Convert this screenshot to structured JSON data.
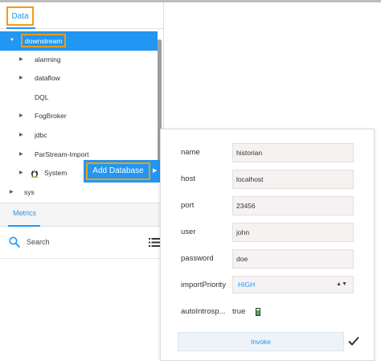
{
  "tabs": {
    "data_label": "Data",
    "metrics_label": "Metrics"
  },
  "tree": {
    "selected": "downstream",
    "items": [
      {
        "label": "alarming"
      },
      {
        "label": "dataflow"
      },
      {
        "label": "DQL"
      },
      {
        "label": "FogBroker"
      },
      {
        "label": "jdbc"
      },
      {
        "label": "ParStream-Import"
      },
      {
        "label": "System"
      },
      {
        "label": "sys"
      }
    ]
  },
  "context_menu": {
    "label": "Add Database"
  },
  "search": {
    "placeholder": "Search"
  },
  "form": {
    "name": {
      "label": "name",
      "value": "historian"
    },
    "host": {
      "label": "host",
      "value": "localhost"
    },
    "port": {
      "label": "port",
      "value": "23456"
    },
    "user": {
      "label": "user",
      "value": "john"
    },
    "password": {
      "label": "password",
      "value": "doe"
    },
    "import_priority": {
      "label": "importPriority",
      "value": "HIGH"
    },
    "auto_introspect": {
      "label": "autoIntrosp...",
      "value": "true"
    },
    "invoke_label": "Invoke"
  },
  "colors": {
    "accent": "#2196f3",
    "highlight": "#f39c12",
    "toggle_on": "#4caf50"
  },
  "icons": [
    "expand-arrow-icon",
    "linux-icon",
    "search-icon",
    "list-icon",
    "checkmark-icon",
    "select-updown-icon"
  ]
}
